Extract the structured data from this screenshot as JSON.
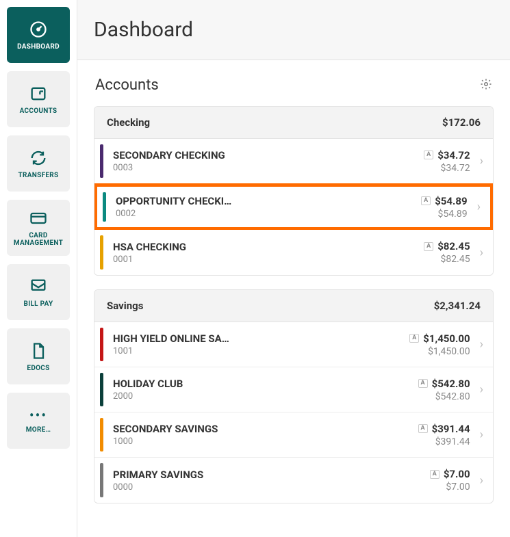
{
  "header": {
    "title": "Dashboard"
  },
  "sidebar": {
    "items": [
      {
        "label": "DASHBOARD",
        "icon": "dashboard",
        "active": true
      },
      {
        "label": "ACCOUNTS",
        "icon": "accounts",
        "active": false
      },
      {
        "label": "TRANSFERS",
        "icon": "transfers",
        "active": false
      },
      {
        "label": "CARD MANAGEMENT",
        "icon": "card",
        "active": false
      },
      {
        "label": "BILL PAY",
        "icon": "billpay",
        "active": false
      },
      {
        "label": "EDOCS",
        "icon": "edocs",
        "active": false
      },
      {
        "label": "MORE…",
        "icon": "more",
        "active": false
      }
    ]
  },
  "accounts_section": {
    "title": "Accounts",
    "badge_letter": "A",
    "groups": [
      {
        "name": "Checking",
        "total": "$172.06",
        "accounts": [
          {
            "name": "SECONDARY CHECKING",
            "number": "0003",
            "balance": "$34.72",
            "available": "$34.72",
            "color": "#4a2a6e",
            "highlight": false
          },
          {
            "name": "OPPORTUNITY CHECKI…",
            "number": "0002",
            "balance": "$54.89",
            "available": "$54.89",
            "color": "#0b8a80",
            "highlight": true
          },
          {
            "name": "HSA CHECKING",
            "number": "0001",
            "balance": "$82.45",
            "available": "$82.45",
            "color": "#e6a100",
            "highlight": false
          }
        ]
      },
      {
        "name": "Savings",
        "total": "$2,341.24",
        "accounts": [
          {
            "name": "HIGH YIELD ONLINE SA…",
            "number": "1001",
            "balance": "$1,450.00",
            "available": "$1,450.00",
            "color": "#c41616",
            "highlight": false
          },
          {
            "name": "HOLIDAY CLUB",
            "number": "2000",
            "balance": "$542.80",
            "available": "$542.80",
            "color": "#0b3f3a",
            "highlight": false
          },
          {
            "name": "SECONDARY SAVINGS",
            "number": "1000",
            "balance": "$391.44",
            "available": "$391.44",
            "color": "#f28c00",
            "highlight": false
          },
          {
            "name": "PRIMARY SAVINGS",
            "number": "0000",
            "balance": "$7.00",
            "available": "$7.00",
            "color": "#777777",
            "highlight": false
          }
        ]
      }
    ]
  }
}
